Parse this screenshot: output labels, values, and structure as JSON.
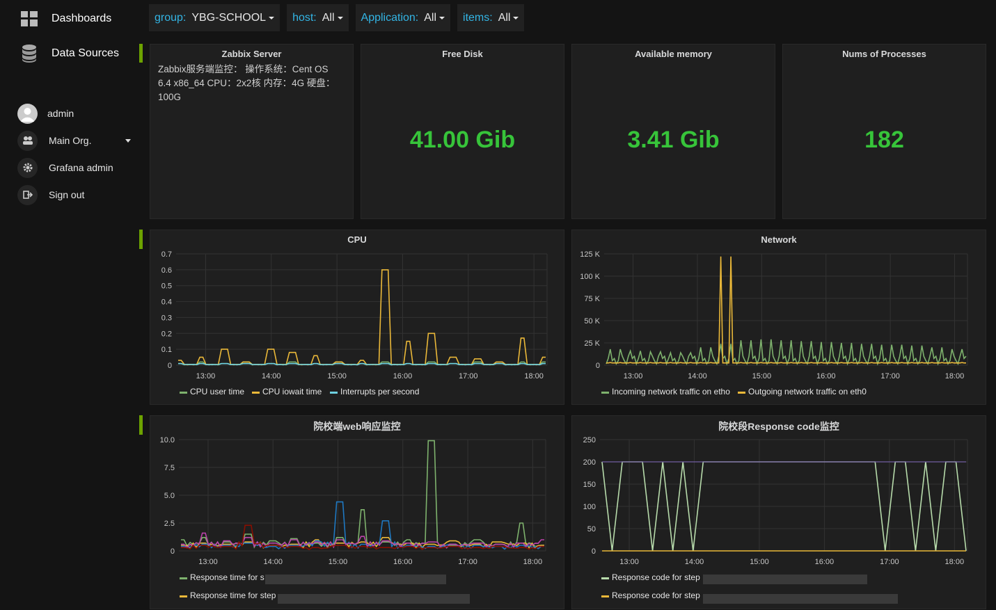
{
  "sidebar": {
    "items": [
      {
        "label": "Dashboards",
        "icon": "dashboards-icon"
      },
      {
        "label": "Data Sources",
        "icon": "database-icon"
      }
    ],
    "user": {
      "name": "admin",
      "org": "Main Org.",
      "grafana_admin": "Grafana admin",
      "sign_out": "Sign out"
    }
  },
  "template_vars": [
    {
      "label": "group:",
      "value": "YBG-SCHOOL"
    },
    {
      "label": "host:",
      "value": "All"
    },
    {
      "label": "Application:",
      "value": "All"
    },
    {
      "label": "items:",
      "value": "All"
    }
  ],
  "singlestats": [
    {
      "title": "Free Disk",
      "value": "41.00 Gib"
    },
    {
      "title": "Available memory",
      "value": "3.41 Gib"
    },
    {
      "title": "Nums of Processes",
      "value": "182"
    }
  ],
  "text_panel": {
    "title": "Zabbix Server",
    "lines": [
      "Zabbix服务端监控： 操作系统：Cent OS",
      "6.4 x86_64 CPU：2x2核 内存：4G 硬盘：",
      "100G"
    ]
  },
  "colors": {
    "green": "#7eb26d",
    "yellow": "#eab839",
    "cyan": "#6ed0e0",
    "value_green": "#37c43a",
    "accent_blue": "#33b5e5",
    "row_marker": "#6ca200"
  },
  "chart_data": [
    {
      "type": "line",
      "title": "CPU",
      "x": [
        "12:30",
        "13:00",
        "13:30",
        "14:00",
        "14:30",
        "15:00",
        "15:30",
        "16:00",
        "16:30",
        "16:45",
        "16:50",
        "17:00",
        "17:10",
        "17:30",
        "17:45",
        "18:00",
        "18:02"
      ],
      "xticks": [
        "13:00",
        "14:00",
        "15:00",
        "16:00",
        "17:00",
        "18:00"
      ],
      "yticks": [
        "0",
        "0.1",
        "0.2",
        "0.3",
        "0.4",
        "0.5",
        "0.6",
        "0.7"
      ],
      "ylim": [
        0,
        0.7
      ],
      "series": [
        {
          "name": "CPU user time",
          "color": "#7eb26d",
          "values": [
            0.01,
            0.02,
            0.01,
            0.02,
            0.01,
            0.02,
            0.01,
            0.02,
            0.01,
            0.02,
            0.01,
            0.02,
            0.01,
            0.02,
            0.01,
            0.02,
            0.02
          ]
        },
        {
          "name": "CPU iowait time",
          "color": "#eab839",
          "values": [
            0.03,
            0.05,
            0.1,
            0.02,
            0.1,
            0.08,
            0.06,
            0.02,
            0.03,
            0.6,
            0.15,
            0.2,
            0.05,
            0.04,
            0.02,
            0.17,
            0.05
          ]
        },
        {
          "name": "Interrupts per second",
          "color": "#6ed0e0",
          "values": [
            0.01,
            0.01,
            0.01,
            0.01,
            0.01,
            0.01,
            0.01,
            0.01,
            0.01,
            0.01,
            0.01,
            0.01,
            0.01,
            0.01,
            0.01,
            0.01,
            0.01
          ]
        }
      ]
    },
    {
      "type": "line",
      "title": "Network",
      "xticks": [
        "13:00",
        "14:00",
        "15:00",
        "16:00",
        "17:00",
        "18:00"
      ],
      "yticks": [
        "0",
        "25 K",
        "50 K",
        "75 K",
        "100 K",
        "125 K"
      ],
      "ylim": [
        0,
        125000
      ],
      "series": [
        {
          "name": "Incoming network traffic on etho",
          "color": "#7eb26d",
          "peak_values": [
            18000,
            16000,
            15000,
            14000,
            20000,
            24000,
            28000,
            29000,
            28000,
            27000,
            26000,
            25000,
            24000,
            23000,
            22000,
            20000,
            18000
          ]
        },
        {
          "name": "Outgoing network traffic on eth0",
          "color": "#eab839",
          "peak_values": [
            3000,
            3000,
            3000,
            3000,
            3000,
            122000,
            3000,
            3000,
            3000,
            3000,
            3000,
            3000,
            3000,
            3000,
            3000,
            3000,
            3000
          ]
        }
      ]
    },
    {
      "type": "line",
      "title": "院校端web响应监控",
      "xticks": [
        "13:00",
        "14:00",
        "15:00",
        "16:00",
        "17:00",
        "18:00"
      ],
      "yticks": [
        "0",
        "2.5",
        "5.0",
        "7.5",
        "10.0"
      ],
      "ylim": [
        0,
        10
      ],
      "series": [
        {
          "name": "Response time for s",
          "color": "#7eb26d",
          "values": [
            1.0,
            1.2,
            0.8,
            1.5,
            0.9,
            1.1,
            0.7,
            1.2,
            3.7,
            0.8,
            1.0,
            9.9,
            0.5,
            1.0,
            0.6,
            2.5,
            0.5
          ]
        },
        {
          "name": "Response time for step",
          "color": "#eab839",
          "values": [
            0.5,
            0.7,
            0.6,
            0.8,
            0.5,
            0.6,
            1.0,
            0.7,
            0.8,
            1.2,
            0.7,
            0.6,
            0.9,
            0.6,
            0.8,
            0.7,
            0.5
          ]
        },
        {
          "name": "",
          "color": "#1f78c1",
          "values": [
            0.4,
            0.6,
            0.5,
            0.7,
            0.4,
            0.5,
            0.9,
            4.4,
            0.6,
            2.7,
            0.5,
            0.4,
            0.6,
            0.5,
            0.4,
            0.5,
            0.4
          ]
        },
        {
          "name": "",
          "color": "#ba43a9",
          "values": [
            0.6,
            1.6,
            0.9,
            1.2,
            0.7,
            1.0,
            0.8,
            1.0,
            1.3,
            0.9,
            0.7,
            0.8,
            0.6,
            0.7,
            0.6,
            0.7,
            1.0
          ]
        },
        {
          "name": "",
          "color": "#890f02",
          "values": [
            0.3,
            0.5,
            0.4,
            2.3,
            0.5,
            0.4,
            0.3,
            0.5,
            0.4,
            0.3,
            0.4,
            0.3,
            0.4,
            0.3,
            0.4,
            0.3,
            0.4
          ]
        }
      ]
    },
    {
      "type": "line",
      "title": "院校段Response code监控",
      "xticks": [
        "13:00",
        "14:00",
        "15:00",
        "16:00",
        "17:00",
        "18:00"
      ],
      "yticks": [
        "0",
        "50",
        "100",
        "150",
        "200",
        "250"
      ],
      "ylim": [
        0,
        250
      ],
      "series": [
        {
          "name": "Response code for step",
          "color": "#b7dbab",
          "values": [
            200,
            0,
            200,
            200,
            200,
            0,
            200,
            0,
            200,
            0,
            200,
            200,
            200,
            200,
            200,
            200,
            200,
            200,
            200,
            200,
            200,
            200,
            200,
            200,
            200,
            200,
            200,
            200,
            0,
            200,
            200,
            0,
            200,
            0,
            200,
            200,
            0
          ]
        },
        {
          "name": "Response code for step",
          "color": "#eab839",
          "values": [
            0,
            0,
            0,
            0,
            0,
            0,
            0,
            0,
            0,
            0,
            0,
            0,
            0,
            0,
            0,
            0,
            0,
            0,
            0,
            0,
            0,
            0,
            0,
            0,
            0,
            0,
            0,
            0,
            0,
            0,
            0,
            0,
            0,
            0,
            0,
            0,
            0
          ]
        },
        {
          "name": "",
          "color": "#705da0",
          "values": [
            200,
            200,
            200,
            200,
            200,
            200,
            200,
            200,
            200,
            200,
            200,
            200,
            200,
            200,
            200,
            200,
            200,
            200,
            200,
            200,
            200,
            200,
            200,
            200,
            200,
            200,
            200,
            200,
            200,
            200,
            200,
            200,
            200,
            200,
            200,
            200,
            200
          ]
        }
      ]
    }
  ]
}
